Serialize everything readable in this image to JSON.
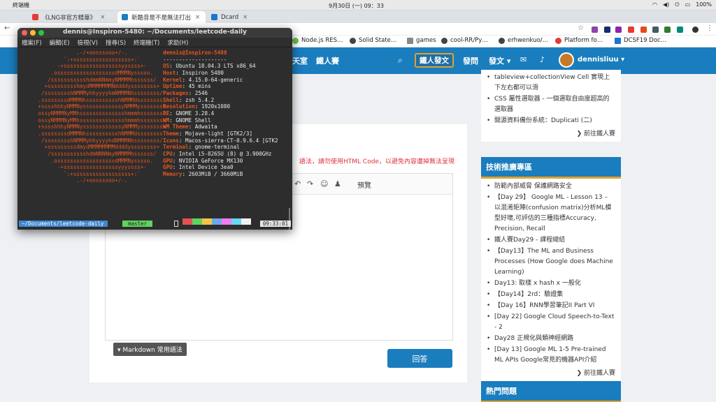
{
  "mac": {
    "app_name": "終端機",
    "clock": "9月30日 (一) 09：33",
    "battery": "100%"
  },
  "tabs": [
    {
      "title": "《LNG非官方精華》",
      "color": "#e53935"
    },
    {
      "title": "新酷音是不是無法打出",
      "color": "#1a7dbe"
    },
    {
      "title": "Dcard",
      "color": "#1976d2"
    }
  ],
  "bookmarks": [
    "Node.js RES…",
    "Solid State…",
    "games",
    "cool-RR/Py…",
    "erhwenkuo/…",
    "Platform fo…",
    "DCSF19 Doc…"
  ],
  "site": {
    "nav": [
      "天室",
      "鐵人賽"
    ],
    "ask_label": "鐵人發文",
    "links": [
      "發問",
      "發文 ▾"
    ],
    "username": "dennisliuu ▾"
  },
  "main": {
    "notice": "語法，請勿使用HTML Code，以避免內容遭掉無法呈現",
    "preview_tab": "預覽",
    "markdown_label": "▾ Markdown 常用語法",
    "answer_label": "回答"
  },
  "sidebar": {
    "top_items": [
      "tableview+collectionView Cell 實現上下左右都可以滑",
      "CSS 屬性選取器 - 一個選取自由度超高的選取器",
      "開源資料備份系統：Duplicati (二)"
    ],
    "more_label": "前往鐵人賽",
    "tech_title": "技術推廣專區",
    "tech_items": [
      "防範內部威脅 保護網路安全",
      "【Day 29】 Google ML - Lesson 13 – 以混淆矩陣(confusion matrix)分析ML模型好壞,可評估的三種指標Accuracy, Precision, Recall",
      "鐵人賽Day29 - 課程總結",
      "【Day13】The ML and Business Processes (How Google does Machine Learning)",
      "Day13: 取樣 x hash x 一般化",
      "【Day14】2rd：驗證集",
      "【Day 16】RNN學習筆記II Part VI",
      "[Day 22] Google Cloud Speech-to-Text - 2",
      "Day28 正規化與類神經網路",
      "[Day 13] Google ML 1-5 Pre-trained ML APIs Google常見的機器API介紹"
    ],
    "tech_more_label": "前往鐵人賽",
    "hot_title": "熱門問題"
  },
  "terminal": {
    "title": "dennis@Inspiron-5480: ~/Documents/leetcode-daily",
    "menu": [
      "檔案(F)",
      "編輯(E)",
      "檢視(V)",
      "搜尋(S)",
      "終端機(T)",
      "求助(H)"
    ],
    "logo": "                  .-/+oossssoo+/-.\n              `:+ssssssssssssssssss+:`\n            -+ssssssssssssssssssyyssss+-\n          .ossssssssssssssssssdMMMNysssso.\n         /ssssssssssshdmmNNmmyNMMMMhssssss/\n        +ssssssssshmydMMMMMMMNddddyssssssss+\n       /sssssssshNMMMyhhyyyyhmNMMMNhssssssss/\n      .ssssssssdMMMNhsssssssssshNMMMdssssssss.\n      +sssshhhyNMMNyssssssssssssyNMMMysssssss+\n      ossyNMMMNyMMhsssssssssssssshmmmhssssssso\n      ossyNMMMNyMMhsssssssssssssshmmmhssssssso\n      +sssshhhyNMMNyssssssssssssyNMMMysssssss+\n      .ssssssssdMMMNhsssssssssshNMMMdssssssss.\n       /sssssssshNMMMyhhyyyyhdNMMMNhssssssss/\n        +sssssssssdmydMMMMMMMMddddyssssssss+\n         /ssssssssssshdmNNNNmyNMMMMhssssss/\n          .ossssssssssssssssssdMMMNysssso.\n            -+sssssssssssssssssyyyssss+-\n              `:+ssssssssssssssssss+:`\n                  .-/+oossssoo+/-.",
    "user_host": "dennis@Inspiron-5480",
    "separator": "--------------------",
    "info": [
      {
        "key": "OS",
        "value": "Ubuntu 18.04.3 LTS x86_64"
      },
      {
        "key": "Host",
        "value": "Inspiron 5480"
      },
      {
        "key": "Kernel",
        "value": "4.15.0-64-generic"
      },
      {
        "key": "Uptime",
        "value": "45 mins"
      },
      {
        "key": "Packages",
        "value": "2546"
      },
      {
        "key": "Shell",
        "value": "zsh 5.4.2"
      },
      {
        "key": "Resolution",
        "value": "1920x1080"
      },
      {
        "key": "DE",
        "value": "GNOME 3.28.4"
      },
      {
        "key": "WM",
        "value": "GNOME Shell"
      },
      {
        "key": "WM Theme",
        "value": "Adwaita"
      },
      {
        "key": "Theme",
        "value": "Mojave-light [GTK2/3]"
      },
      {
        "key": "Icons",
        "value": "Macos-sierra-CT-0.9.6.4 [GTK2"
      },
      {
        "key": "Terminal",
        "value": "gnome-terminal"
      },
      {
        "key": "CPU",
        "value": "Intel i5-8265U (8) @ 3.900GHz"
      },
      {
        "key": "GPU",
        "value": "NVIDIA GeForce MX130"
      },
      {
        "key": "GPU",
        "value": "Intel Device 3ea0"
      },
      {
        "key": "Memory",
        "value": "2603MiB / 3660MiB"
      }
    ],
    "palette": [
      "#2d2d2d",
      "#e05353",
      "#5fd35f",
      "#f4c542",
      "#6ba8ec",
      "#f07cf0",
      "#66d9ef",
      "#f2f2f2"
    ],
    "prompt_dir": "~/Documents/leetcode-daily",
    "prompt_git": "master",
    "prompt_time": "09:33:01"
  }
}
